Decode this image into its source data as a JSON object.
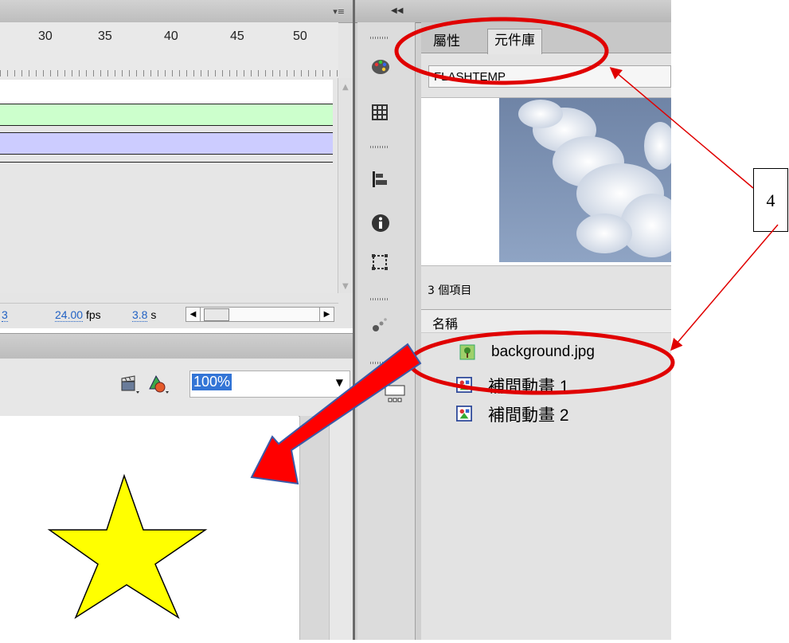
{
  "timeline": {
    "ruler_labels": [
      "30",
      "35",
      "40",
      "45",
      "50"
    ],
    "frame_num_partial": "3",
    "fps": "24.00",
    "fps_unit": "fps",
    "time": "3.8",
    "time_unit": "s"
  },
  "stage": {
    "zoom": "100%"
  },
  "library": {
    "tabs": [
      {
        "label": "屬性"
      },
      {
        "label": "元件庫"
      }
    ],
    "document": "FLASHTEMP",
    "item_count": "3 個項目",
    "column_name": "名稱",
    "items": [
      {
        "label": "background.jpg",
        "icon": "bitmap-icon"
      },
      {
        "label": "補間動畫 1",
        "icon": "motion-tween-icon"
      },
      {
        "label": "補間動畫 2",
        "icon": "motion-tween-icon"
      }
    ]
  },
  "annotation": {
    "callout": "4"
  },
  "colors": {
    "annotation_red": "#e00000",
    "star_fill": "#ffff00",
    "layer_green": "#ccffcc",
    "layer_blue": "#ccccff",
    "zoom_highlight": "#3375d6"
  }
}
